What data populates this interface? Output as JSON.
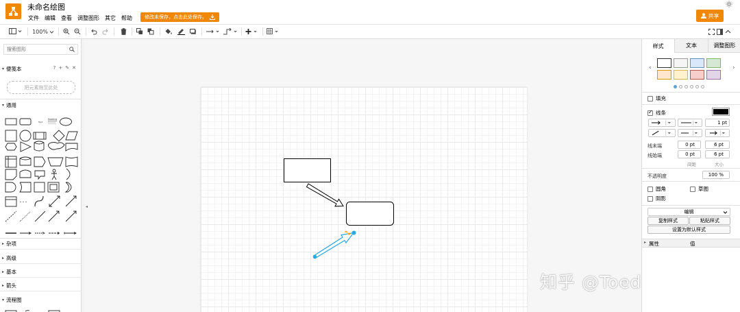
{
  "header": {
    "title": "未命名绘图",
    "menu": [
      "文件",
      "编辑",
      "查看",
      "调整图形",
      "其它",
      "帮助"
    ],
    "save_warning": "修改未保存，点击此处保存。",
    "share_label": "共享",
    "brand_color": "#f08705"
  },
  "toolbar": {
    "zoom": "100%"
  },
  "left_panel": {
    "search_placeholder": "搜索图形",
    "scratchpad_title": "便笺本",
    "scratchpad_help": "?",
    "drop_hint": "把元素拖至此处",
    "general_title": "通用",
    "sections": [
      "杂项",
      "高级",
      "基本",
      "箭头",
      "流程图"
    ],
    "mini_labels": {
      "text": "Text",
      "heading": "Heading"
    }
  },
  "right_panel": {
    "tabs": [
      "样式",
      "文本",
      "调整图形"
    ],
    "fill_label": "填充",
    "line_label": "线条",
    "line_width": "1 pt",
    "line_start_label": "线末端",
    "line_end_label": "线始端",
    "start_spacing": "0 pt",
    "start_size": "6 pt",
    "end_spacing": "0 pt",
    "end_size": "6 pt",
    "spacing_label": "间距",
    "size_label": "大小",
    "opacity_label": "不透明度",
    "opacity_value": "100 %",
    "rounded_label": "圆角",
    "sketch_label": "草图",
    "shadow_label": "阴影",
    "edit_style_select": "编辑",
    "copy_style": "复制样式",
    "paste_style": "粘贴样式",
    "set_default_style": "设置为默认样式",
    "property_col": "属性",
    "value_col": "值",
    "line_color": "#000000",
    "swatches": [
      "#ffffff",
      "#f5f5f5",
      "#dae8fc",
      "#d5e8d4",
      "#ffe6cc",
      "#fff2cc",
      "#f8cecc",
      "#e1d5e7"
    ]
  },
  "canvas": {
    "selection_color": "#29a8e0",
    "watermark": "知乎 @Toedit学术"
  }
}
